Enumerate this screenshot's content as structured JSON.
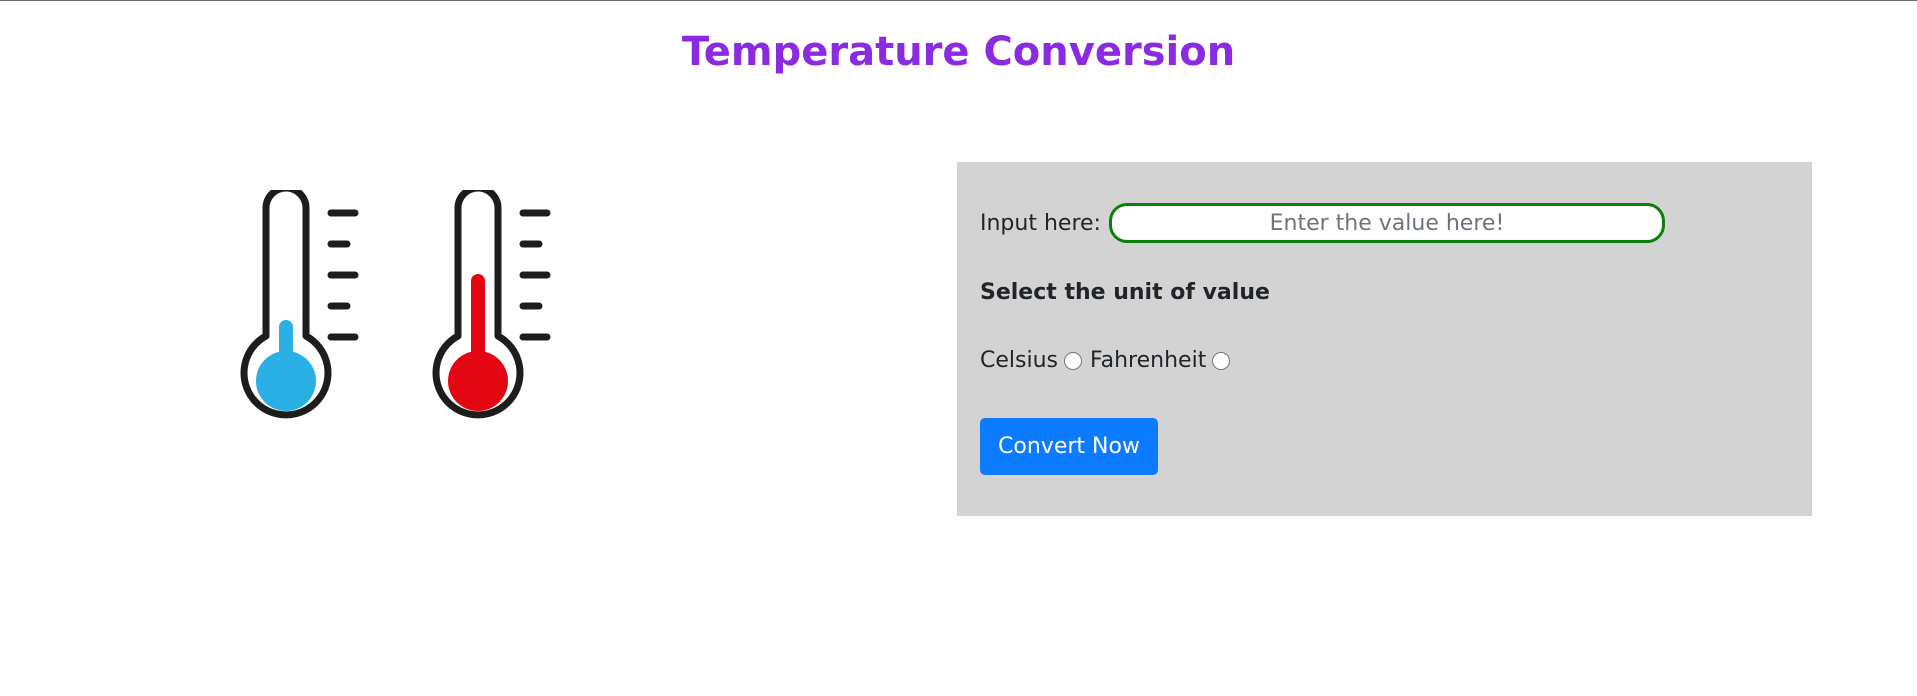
{
  "title": "Temperature Conversion",
  "thermometers": [
    {
      "icon": "thermometer-cold-icon",
      "fill_color": "#2bb0e6",
      "level": 0.25
    },
    {
      "icon": "thermometer-hot-icon",
      "fill_color": "#e30613",
      "level": 0.75
    }
  ],
  "form": {
    "input_label": "Input here:",
    "input_placeholder": "Enter the value here!",
    "input_value": "",
    "unit_heading": "Select the unit of value",
    "units": [
      {
        "label": "Celsius",
        "selected": false
      },
      {
        "label": "Fahrenheit",
        "selected": false
      }
    ],
    "convert_label": "Convert Now"
  },
  "colors": {
    "title": "#8a2be2",
    "panel_bg": "#d3d3d3",
    "input_border": "#0a7f0a",
    "button_bg": "#0d7bff"
  }
}
